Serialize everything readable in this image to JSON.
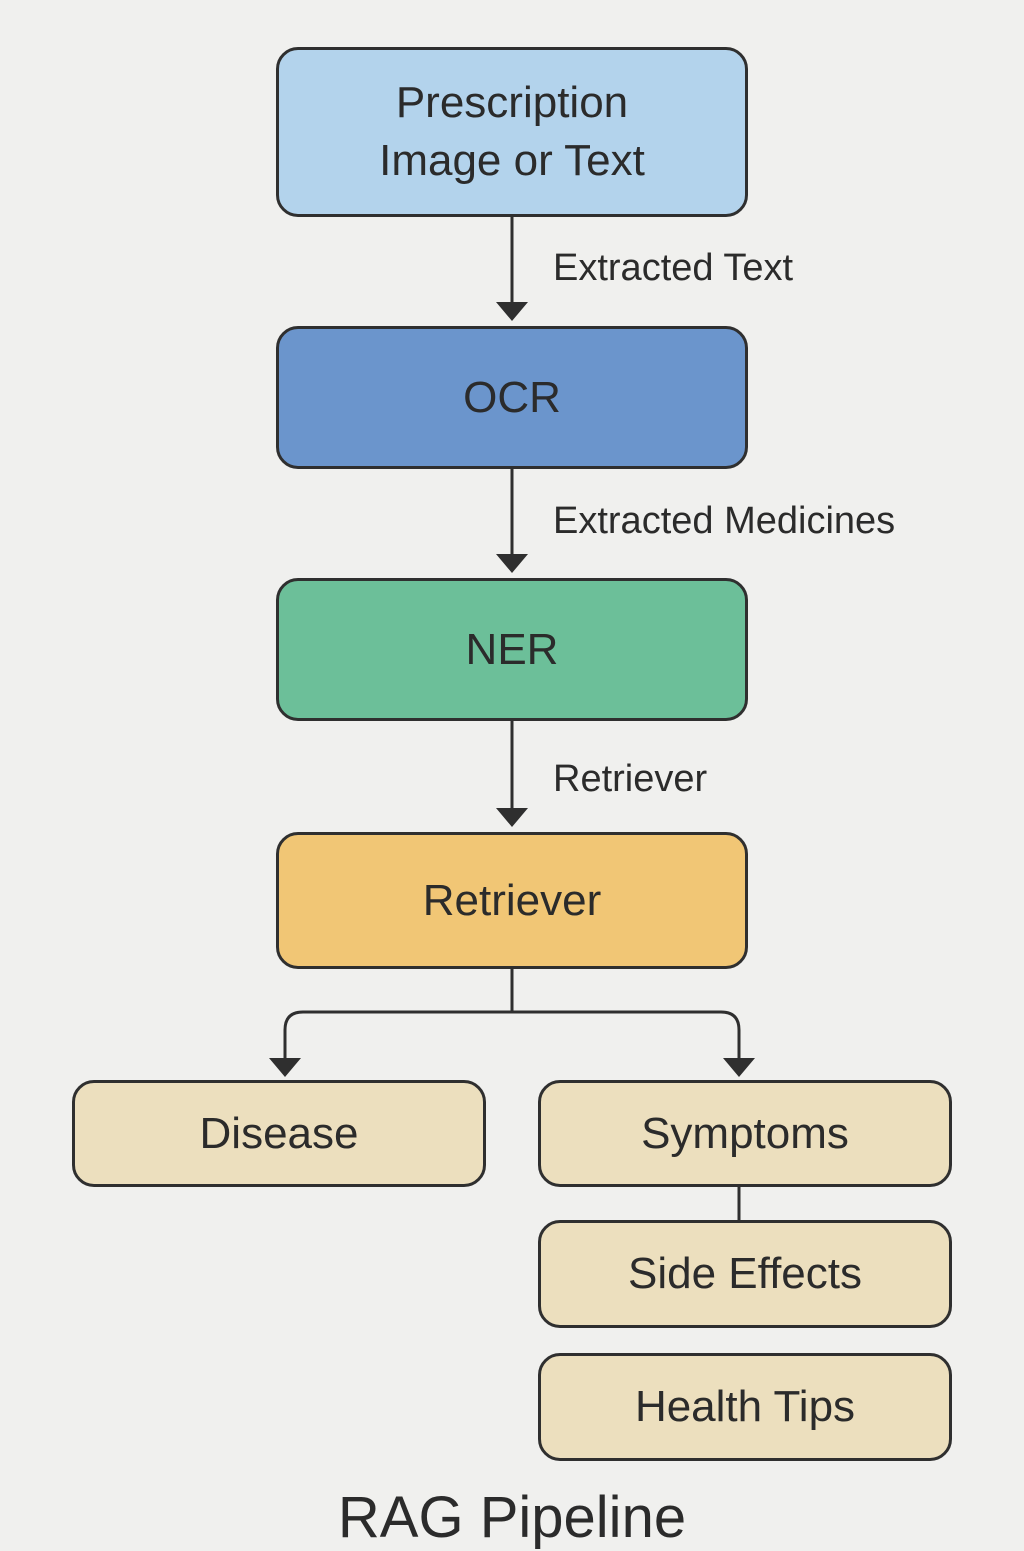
{
  "diagram": {
    "title": "RAG Pipeline",
    "nodes": {
      "input": {
        "line1": "Prescription",
        "line2": "Image or Text"
      },
      "ocr": {
        "label": "OCR"
      },
      "ner": {
        "label": "NER"
      },
      "retriever": {
        "label": "Retriever"
      },
      "disease": {
        "label": "Disease"
      },
      "symptoms": {
        "label": "Symptoms"
      },
      "side_effects": {
        "label": "Side Effects"
      },
      "health_tips": {
        "label": "Health Tips"
      }
    },
    "edge_labels": {
      "input_to_ocr": "Extracted Text",
      "ocr_to_ner": "Extracted Medicines",
      "ner_to_retriever": "Retriever"
    },
    "colors": {
      "input": "#b3d3ec",
      "ocr": "#6b95cc",
      "ner": "#6cbf99",
      "retriever": "#f1c675",
      "outputs": "#ecdfbe",
      "stroke": "#2f2f2f"
    }
  }
}
